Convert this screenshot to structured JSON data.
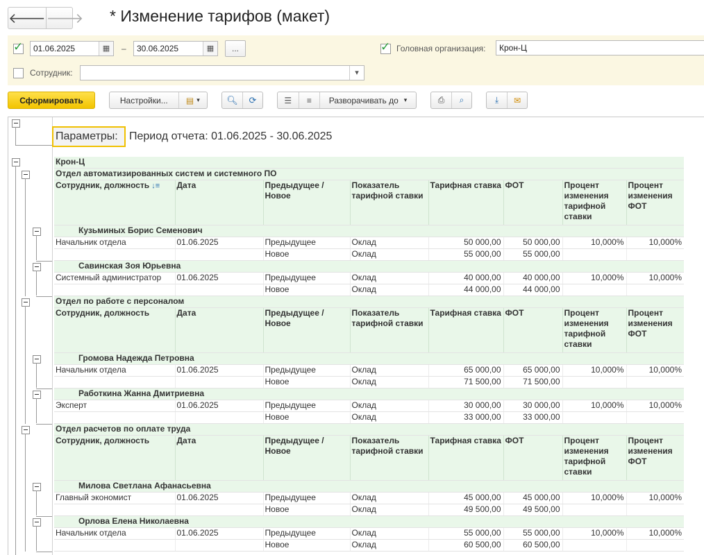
{
  "window": {
    "title": "* Изменение тарифов (макет)",
    "back_icon": "arrow-left-icon",
    "forward_icon": "arrow-right-icon"
  },
  "params": {
    "date_from": "01.06.2025",
    "date_to": "30.06.2025",
    "dash": "–",
    "ellipsis_label": "...",
    "head_org_label": "Головная организация:",
    "head_org_value": "Крон-Ц",
    "employee_label": "Сотрудник:",
    "employee_value": "",
    "period_checked": true,
    "head_org_checked": true,
    "employee_checked": false
  },
  "toolbar": {
    "generate_label": "Сформировать",
    "settings_label": "Настройки...",
    "expand_label": "Разворачивать до"
  },
  "report": {
    "params_label": "Параметры:",
    "period_text": "Период отчета: 01.06.2025 - 30.06.2025",
    "org": "Крон-Ц",
    "headers": [
      "Сотрудник, должность",
      "Дата",
      "Предыдущее / Новое",
      "Показатель тарифной ставки",
      "Тарифная ставка",
      "ФОТ",
      "Процент изменения тарифной ставки",
      "Процент изменения ФОТ"
    ],
    "departments": [
      {
        "name": "Отдел автоматизированных систем и системного ПО",
        "employees": [
          {
            "name": "Кузьминых Борис Семенович",
            "position": "Начальник отдела",
            "date": "01.06.2025",
            "rows": [
              {
                "kind": "Предыдущее",
                "indicator": "Оклад",
                "rate": "50 000,00",
                "fot": "50 000,00",
                "rate_pct": "10,000%",
                "fot_pct": "10,000%"
              },
              {
                "kind": "Новое",
                "indicator": "Оклад",
                "rate": "55 000,00",
                "fot": "55 000,00",
                "rate_pct": "",
                "fot_pct": ""
              }
            ]
          },
          {
            "name": "Савинская Зоя Юрьевна",
            "position": "Системный администратор",
            "date": "01.06.2025",
            "rows": [
              {
                "kind": "Предыдущее",
                "indicator": "Оклад",
                "rate": "40 000,00",
                "fot": "40 000,00",
                "rate_pct": "10,000%",
                "fot_pct": "10,000%"
              },
              {
                "kind": "Новое",
                "indicator": "Оклад",
                "rate": "44 000,00",
                "fot": "44 000,00",
                "rate_pct": "",
                "fot_pct": ""
              }
            ]
          }
        ]
      },
      {
        "name": "Отдел по работе с персоналом",
        "employees": [
          {
            "name": "Громова Надежда Петровна",
            "position": "Начальник отдела",
            "date": "01.06.2025",
            "rows": [
              {
                "kind": "Предыдущее",
                "indicator": "Оклад",
                "rate": "65 000,00",
                "fot": "65 000,00",
                "rate_pct": "10,000%",
                "fot_pct": "10,000%"
              },
              {
                "kind": "Новое",
                "indicator": "Оклад",
                "rate": "71 500,00",
                "fot": "71 500,00",
                "rate_pct": "",
                "fot_pct": ""
              }
            ]
          },
          {
            "name": "Работкина Жанна Дмитриевна",
            "position": "Эксперт",
            "date": "01.06.2025",
            "rows": [
              {
                "kind": "Предыдущее",
                "indicator": "Оклад",
                "rate": "30 000,00",
                "fot": "30 000,00",
                "rate_pct": "10,000%",
                "fot_pct": "10,000%"
              },
              {
                "kind": "Новое",
                "indicator": "Оклад",
                "rate": "33 000,00",
                "fot": "33 000,00",
                "rate_pct": "",
                "fot_pct": ""
              }
            ]
          }
        ]
      },
      {
        "name": "Отдел расчетов по оплате труда",
        "employees": [
          {
            "name": "Милова Светлана Афанасьевна",
            "position": "Главный экономист",
            "date": "01.06.2025",
            "rows": [
              {
                "kind": "Предыдущее",
                "indicator": "Оклад",
                "rate": "45 000,00",
                "fot": "45 000,00",
                "rate_pct": "10,000%",
                "fot_pct": "10,000%"
              },
              {
                "kind": "Новое",
                "indicator": "Оклад",
                "rate": "49 500,00",
                "fot": "49 500,00",
                "rate_pct": "",
                "fot_pct": ""
              }
            ]
          },
          {
            "name": "Орлова Елена Николаевна",
            "position": "Начальник отдела",
            "date": "01.06.2025",
            "rows": [
              {
                "kind": "Предыдущее",
                "indicator": "Оклад",
                "rate": "55 000,00",
                "fot": "55 000,00",
                "rate_pct": "10,000%",
                "fot_pct": "10,000%"
              },
              {
                "kind": "Новое",
                "indicator": "Оклад",
                "rate": "60 500,00",
                "fot": "60 500,00",
                "rate_pct": "",
                "fot_pct": ""
              }
            ]
          }
        ]
      }
    ]
  }
}
